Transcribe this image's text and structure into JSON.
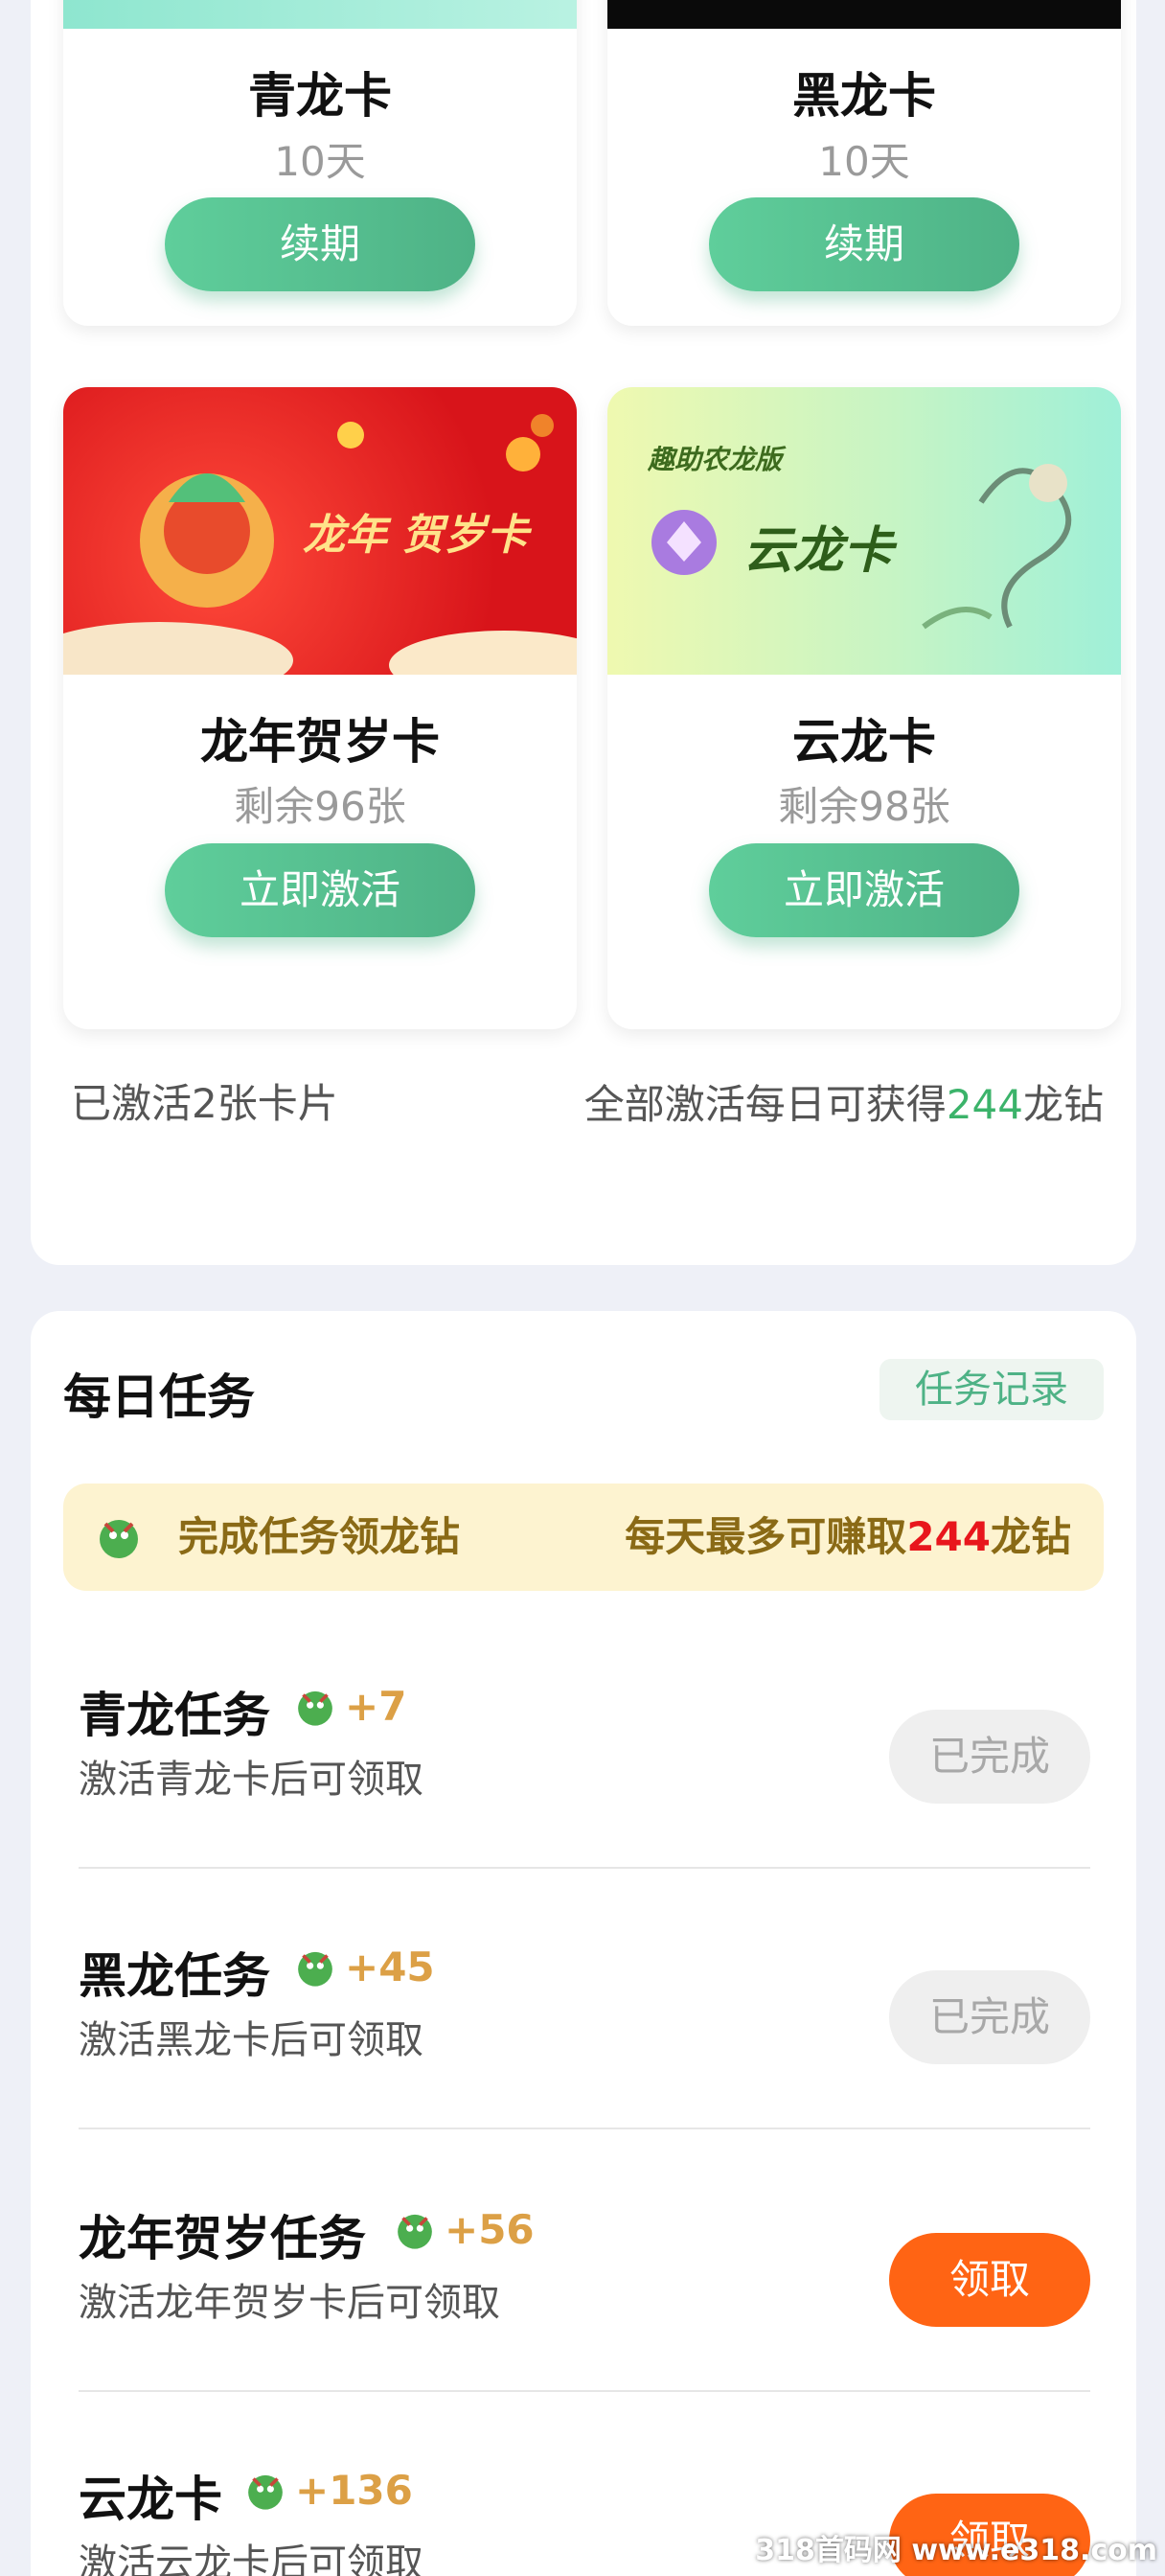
{
  "cards": [
    {
      "title": "青龙卡",
      "sub": "10天",
      "button": "续期"
    },
    {
      "title": "黑龙卡",
      "sub": "10天",
      "button": "续期"
    },
    {
      "title": "龙年贺岁卡",
      "sub": "剩余96张",
      "button": "立即激活",
      "image_text": "龙年 贺岁卡"
    },
    {
      "title": "云龙卡",
      "sub": "剩余98张",
      "button": "立即激活",
      "image_text": "云龙卡",
      "image_tag": "趣助农龙版"
    }
  ],
  "summary": {
    "activated": "已激活2张卡片",
    "daily_prefix": "全部激活每日可获得",
    "daily_amount": "244",
    "daily_suffix": "龙钻"
  },
  "tasks_section": {
    "title": "每日任务",
    "record_button": "任务记录",
    "banner_left": "完成任务领龙钻",
    "banner_right_prefix": "每天最多可赚取",
    "banner_right_amount": "244",
    "banner_right_suffix": "龙钻"
  },
  "tasks": [
    {
      "title": "青龙任务",
      "reward": "+7",
      "desc": "激活青龙卡后可领取",
      "button": "已完成",
      "state": "done"
    },
    {
      "title": "黑龙任务",
      "reward": "+45",
      "desc": "激活黑龙卡后可领取",
      "button": "已完成",
      "state": "done"
    },
    {
      "title": "龙年贺岁任务",
      "reward": "+56",
      "desc": "激活龙年贺岁卡后可领取",
      "button": "领取",
      "state": "claim"
    },
    {
      "title": "云龙卡",
      "reward": "+136",
      "desc": "激活云龙卡后可领取",
      "button": "领取",
      "state": "claim"
    }
  ],
  "watermark": "318首码网 www.e318.com",
  "colors": {
    "green": "#4eb286",
    "orange": "#ff6414",
    "gold": "#dca046",
    "red": "#e8161c"
  }
}
